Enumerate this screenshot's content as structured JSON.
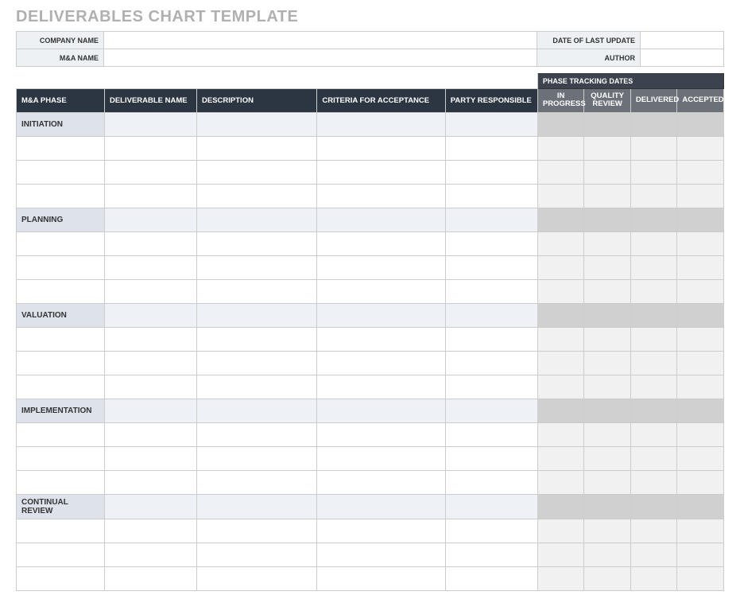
{
  "title": "DELIVERABLES CHART TEMPLATE",
  "meta": {
    "company_name_label": "COMPANY NAME",
    "company_name_value": "",
    "date_update_label": "DATE OF LAST UPDATE",
    "date_update_value": "",
    "ma_name_label": "M&A NAME",
    "ma_name_value": "",
    "author_label": "AUTHOR",
    "author_value": ""
  },
  "headers": {
    "phase_tracking_dates": "PHASE TRACKING DATES",
    "ma_phase": "M&A PHASE",
    "deliverable_name": "DELIVERABLE NAME",
    "description": "DESCRIPTION",
    "criteria": "CRITERIA FOR ACCEPTANCE",
    "party": "PARTY RESPONSIBLE",
    "in_progress": "IN PROGRESS",
    "quality_review": "QUALITY REVIEW",
    "delivered": "DELIVERED",
    "accepted": "ACCEPTED"
  },
  "phases": {
    "initiation": "INITIATION",
    "planning": "PLANNING",
    "valuation": "VALUATION",
    "implementation": "IMPLEMENTATION",
    "continual_review": "CONTINUAL REVIEW"
  }
}
